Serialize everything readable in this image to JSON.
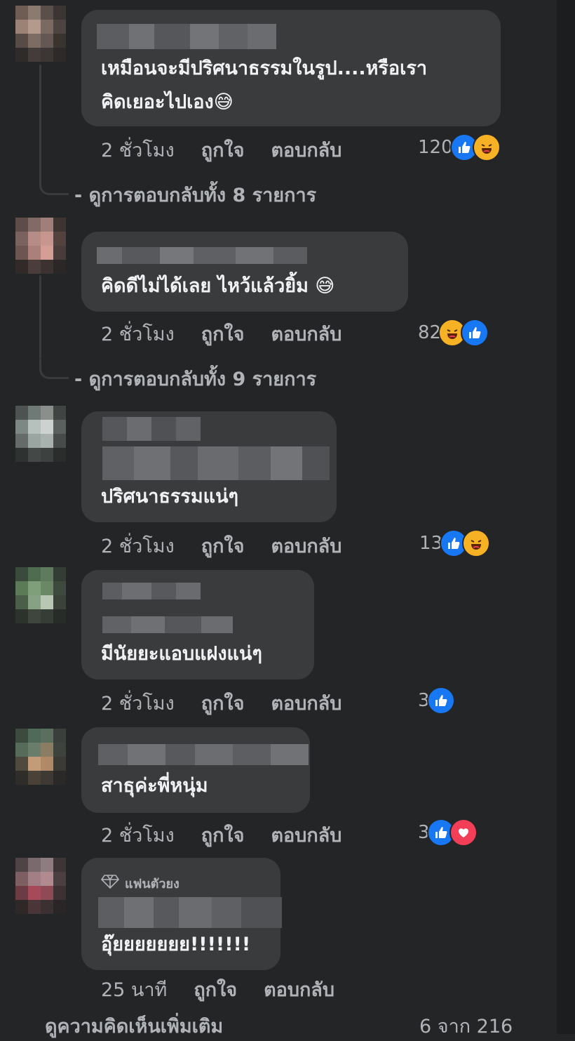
{
  "comments": [
    {
      "text_lines": [
        "เหมือนจะมีปริศนาธรรมในรูป....หรือเรา",
        "คิดเยอะไปเอง😅"
      ],
      "time": "2 ชั่วโมง",
      "like_label": "ถูกใจ",
      "reply_label": "ตอบกลับ",
      "reaction_count": "120",
      "reactions": [
        "like-icon",
        "haha-icon"
      ],
      "view_replies": "ดูการตอบกลับทั้ง 8 รายการ"
    },
    {
      "text_lines": [
        "คิดดีไม่ได้เลย ไหว้แล้วยิ้ม 😅"
      ],
      "time": "2 ชั่วโมง",
      "like_label": "ถูกใจ",
      "reply_label": "ตอบกลับ",
      "reaction_count": "82",
      "reactions": [
        "haha-icon",
        "like-icon"
      ],
      "view_replies": "ดูการตอบกลับทั้ง 9 รายการ"
    },
    {
      "text_lines": [
        "ปริศนาธรรมแน่ๆ"
      ],
      "time": "2 ชั่วโมง",
      "like_label": "ถูกใจ",
      "reply_label": "ตอบกลับ",
      "reaction_count": "13",
      "reactions": [
        "like-icon",
        "haha-icon"
      ]
    },
    {
      "text_lines": [
        "มีนัยยะแอบแฝงแน่ๆ"
      ],
      "time": "2 ชั่วโมง",
      "like_label": "ถูกใจ",
      "reply_label": "ตอบกลับ",
      "reaction_count": "3",
      "reactions": [
        "like-icon"
      ]
    },
    {
      "text_lines": [
        "สาธุค่ะพี่หนุ่ม"
      ],
      "time": "2 ชั่วโมง",
      "like_label": "ถูกใจ",
      "reply_label": "ตอบกลับ",
      "reaction_count": "3",
      "reactions": [
        "like-icon",
        "love-icon"
      ]
    },
    {
      "badge": "แฟนตัวยง",
      "text_lines": [
        "อุ๊ยยยยยยย!!!!!!!"
      ],
      "time": "25 นาที",
      "like_label": "ถูกใจ",
      "reply_label": "ตอบกลับ"
    }
  ],
  "footer": {
    "more_comments": "ดูความคิดเห็นเพิ่มเติม",
    "pager": "6 จาก 216"
  },
  "colors": {
    "background": "#242526",
    "bubble": "#3a3b3c",
    "like_blue": "#1877f2",
    "haha_yellow": "#f7b125",
    "love_red": "#f33e58"
  }
}
